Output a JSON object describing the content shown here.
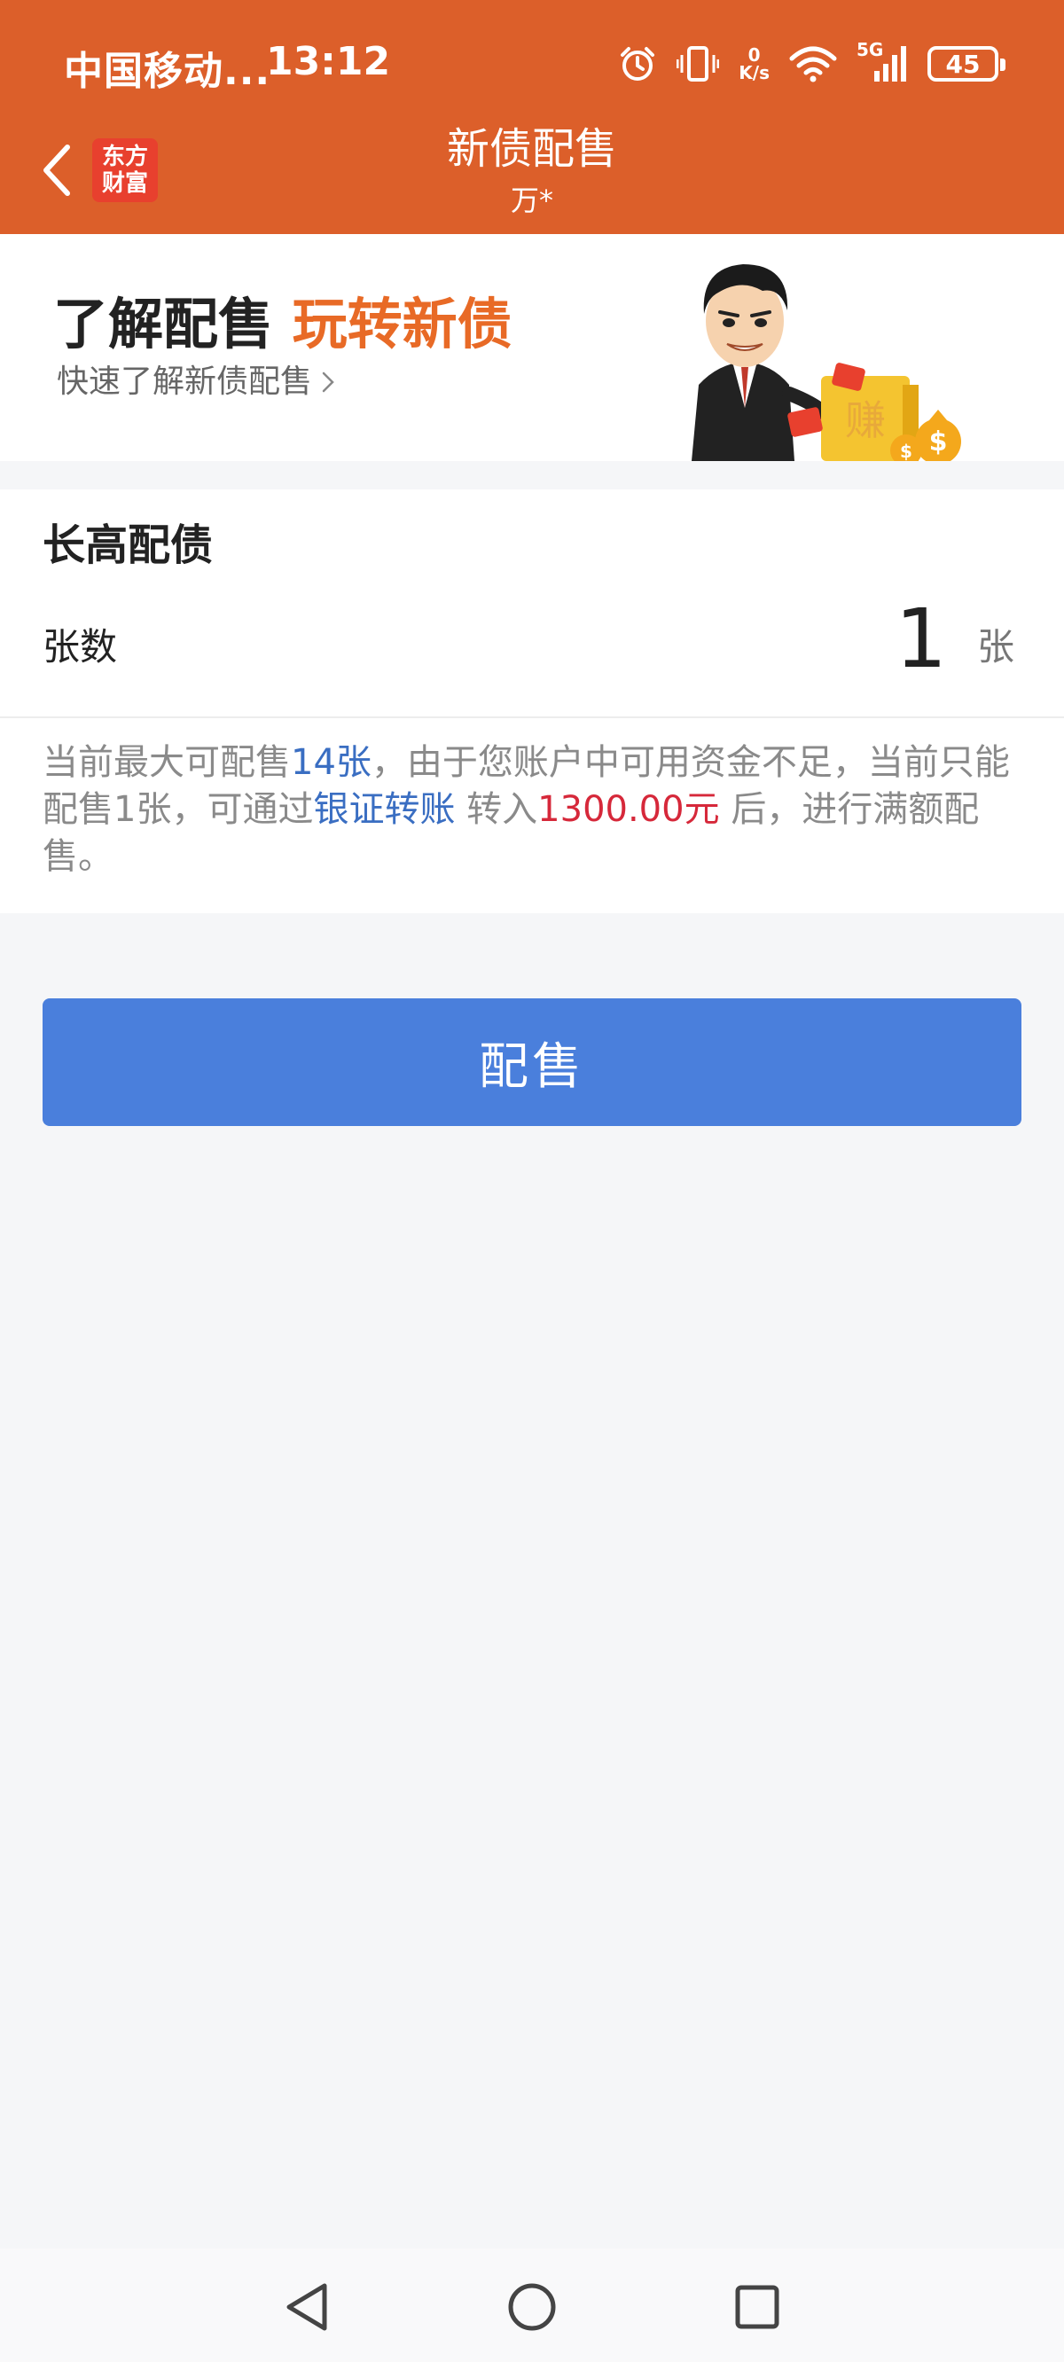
{
  "status_bar": {
    "carrier": "中国移动...",
    "time": "13:12",
    "net_speed_value": "0",
    "net_speed_unit": "K/s",
    "network": "5G",
    "battery": "45",
    "icons": [
      "alarm-icon",
      "vibrate-icon",
      "wifi-icon",
      "signal-icon",
      "battery-icon"
    ]
  },
  "nav": {
    "logo_line1": "东方",
    "logo_line2": "财富",
    "title": "新债配售",
    "subtitle": "万*"
  },
  "banner": {
    "headline_part1": "了解配售",
    "headline_part2": "玩转新债",
    "link_text": "快速了解新债配售",
    "art_text": "赚"
  },
  "allotment": {
    "bond_name": "长高配债",
    "quantity_label": "张数",
    "quantity_value": "1",
    "quantity_unit": "张"
  },
  "notice": {
    "part1": "当前最大可配售",
    "max_qty": "14张",
    "part2": "，由于您账户中可用资金不足，当前只能配售1张，可通过",
    "transfer_link": "银证转账",
    "part3": "转入",
    "amount": "1300.00元",
    "part4": "后，进行满额配售。"
  },
  "action": {
    "submit_label": "配售"
  },
  "colors": {
    "header_bg": "#dc5f2a",
    "accent_orange": "#e86a26",
    "link_blue": "#3a6ec2",
    "amount_red": "#d6283a",
    "button_blue": "#4a7fdc"
  }
}
